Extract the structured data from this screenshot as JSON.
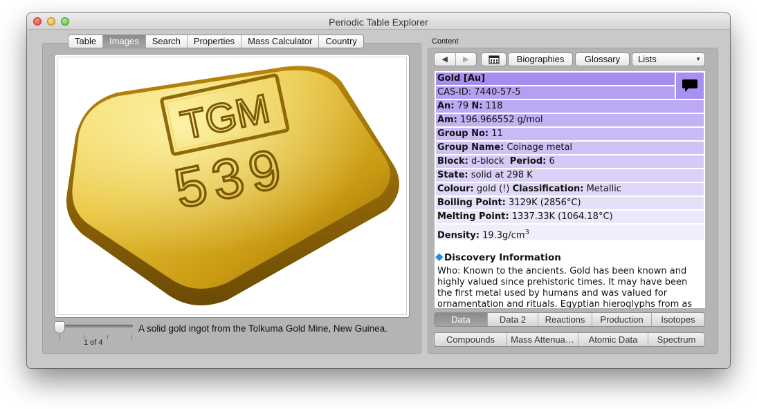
{
  "window": {
    "title": "Periodic Table Explorer"
  },
  "left_tabs": [
    "Table",
    "Images",
    "Search",
    "Properties",
    "Mass Calculator",
    "Country"
  ],
  "left_active_tab": "Images",
  "image": {
    "caption": "A solid gold ingot from the Tolkuma Gold Mine, New Guinea.",
    "page_indicator": "1 of 4",
    "ingot_stamp_line1": "TGM",
    "ingot_stamp_line2": "539"
  },
  "content": {
    "label": "Content",
    "toolbar": {
      "back_icon": "◀",
      "forward_icon": "▶",
      "calendar_icon": "calendar-icon",
      "biographies": "Biographies",
      "glossary": "Glossary",
      "lists": "Lists",
      "lists_arrow": "▼"
    },
    "element": {
      "name": "Gold [Au]",
      "cas_label": "CAS-ID:",
      "cas": "7440-57-5",
      "an_label": "An:",
      "an": "79",
      "n_label": "N:",
      "n": "118",
      "am_label": "Am:",
      "am": "196.966552 g/mol",
      "group_no_label": "Group No:",
      "group_no": "11",
      "group_name_label": "Group Name:",
      "group_name": "Coinage metal",
      "block_label": "Block:",
      "block": "d-block",
      "period_label": "Period:",
      "period": "6",
      "state_label": "State:",
      "state": "solid at 298 K",
      "colour_label": "Colour:",
      "colour": "gold (!)",
      "classification_label": "Classification:",
      "classification": "Metallic",
      "boiling_label": "Boiling Point:",
      "boiling": "3129K (2856°C)",
      "melting_label": "Melting Point:",
      "melting": "1337.33K (1064.18°C)",
      "density_label": "Density:",
      "density": "19.3g/cm",
      "density_sup": "3"
    },
    "discovery": {
      "title": "Discovery Information",
      "text": "Who: Known to the ancients. Gold has been known and highly valued since prehistoric times. It may have been the first metal used by humans and was valued for ornamentation and rituals. Egyptian hieroglyphs from as"
    },
    "tabs_row1": [
      "Data",
      "Data 2",
      "Reactions",
      "Production",
      "Isotopes"
    ],
    "tabs_row1_active": "Data",
    "tabs_row2": [
      "Compounds",
      "Mass Attenua…",
      "Atomic Data",
      "Spectrum"
    ]
  },
  "colors": {
    "row_shades": [
      "#a78df0",
      "#b4a0f2",
      "#bba9f3",
      "#c2b2f4",
      "#c8baf5",
      "#cec1f6",
      "#d4c9f7",
      "#dad0f8",
      "#e0d8f9",
      "#e6dffa",
      "#ece7fb",
      "#f1eefc",
      "#f6f4fd"
    ]
  }
}
